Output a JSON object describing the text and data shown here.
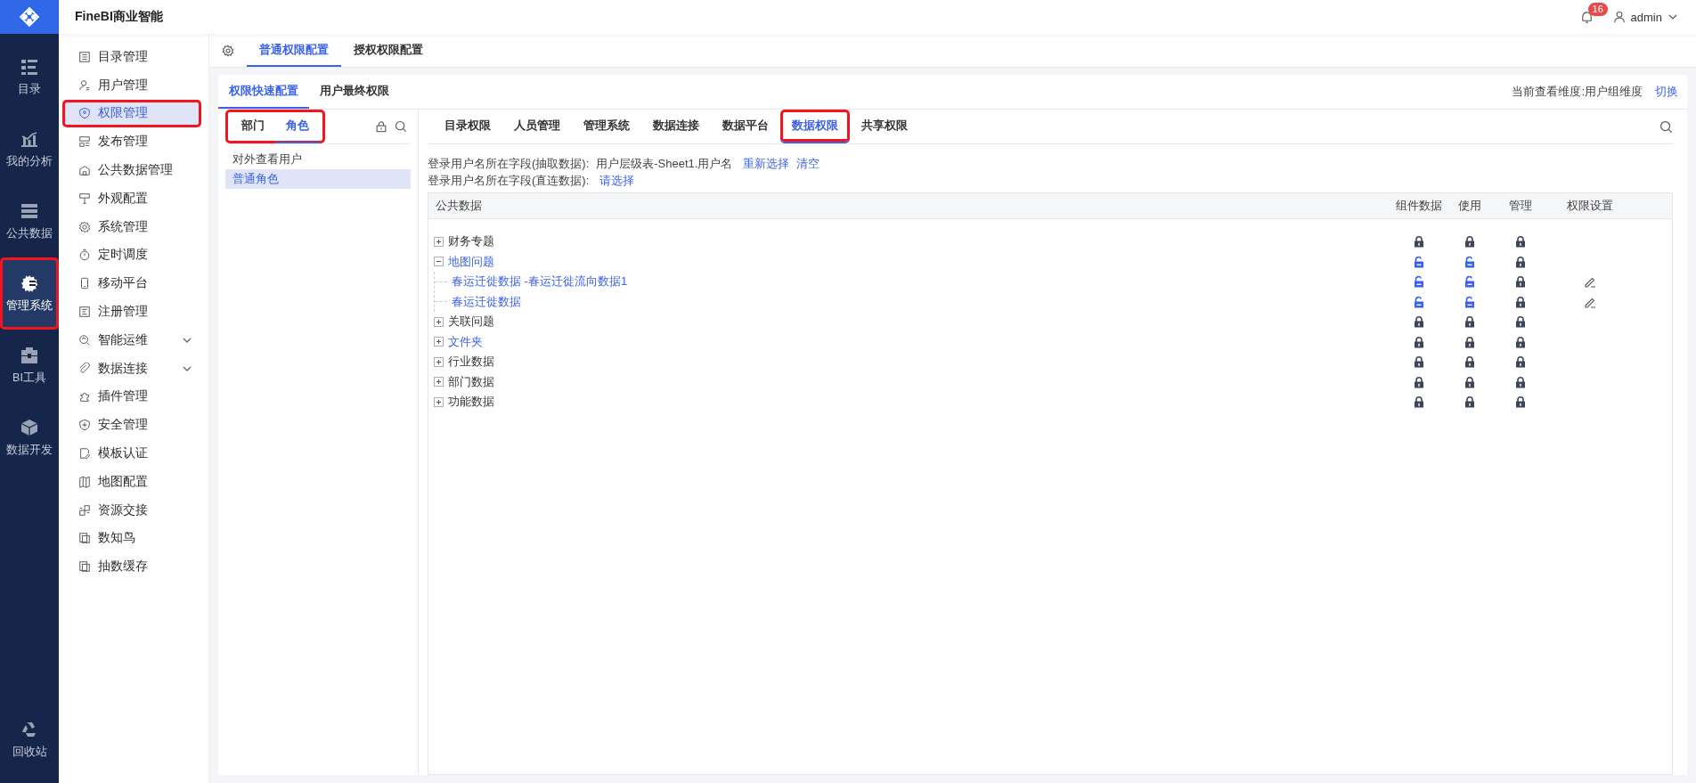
{
  "app": {
    "title": "FineBI商业智能"
  },
  "nav": [
    {
      "label": "目录",
      "selected": false,
      "highlighted": false
    },
    {
      "label": "我的分析",
      "selected": false,
      "highlighted": false
    },
    {
      "label": "公共数据",
      "selected": false,
      "highlighted": false
    },
    {
      "label": "管理系统",
      "selected": true,
      "highlighted": true
    },
    {
      "label": "BI工具",
      "selected": false,
      "highlighted": false
    },
    {
      "label": "数据开发",
      "selected": false,
      "highlighted": false
    }
  ],
  "nav_bottom": {
    "label": "回收站"
  },
  "topbar": {
    "notifications": "16",
    "user": "admin"
  },
  "sidebar": {
    "items": [
      {
        "label": "目录管理",
        "selected": false,
        "highlighted": false,
        "expandable": false
      },
      {
        "label": "用户管理",
        "selected": false,
        "highlighted": false,
        "expandable": false
      },
      {
        "label": "权限管理",
        "selected": true,
        "highlighted": true,
        "expandable": false
      },
      {
        "label": "发布管理",
        "selected": false,
        "highlighted": false,
        "expandable": false
      },
      {
        "label": "公共数据管理",
        "selected": false,
        "highlighted": false,
        "expandable": false
      },
      {
        "label": "外观配置",
        "selected": false,
        "highlighted": false,
        "expandable": false
      },
      {
        "label": "系统管理",
        "selected": false,
        "highlighted": false,
        "expandable": false
      },
      {
        "label": "定时调度",
        "selected": false,
        "highlighted": false,
        "expandable": false
      },
      {
        "label": "移动平台",
        "selected": false,
        "highlighted": false,
        "expandable": false
      },
      {
        "label": "注册管理",
        "selected": false,
        "highlighted": false,
        "expandable": false
      },
      {
        "label": "智能运维",
        "selected": false,
        "highlighted": false,
        "expandable": true
      },
      {
        "label": "数据连接",
        "selected": false,
        "highlighted": false,
        "expandable": true
      },
      {
        "label": "插件管理",
        "selected": false,
        "highlighted": false,
        "expandable": false
      },
      {
        "label": "安全管理",
        "selected": false,
        "highlighted": false,
        "expandable": false
      },
      {
        "label": "模板认证",
        "selected": false,
        "highlighted": false,
        "expandable": false
      },
      {
        "label": "地图配置",
        "selected": false,
        "highlighted": false,
        "expandable": false
      },
      {
        "label": "资源交接",
        "selected": false,
        "highlighted": false,
        "expandable": false
      },
      {
        "label": "数知鸟",
        "selected": false,
        "highlighted": false,
        "expandable": false
      },
      {
        "label": "抽数缓存",
        "selected": false,
        "highlighted": false,
        "expandable": false
      }
    ]
  },
  "main_tabs": [
    {
      "label": "普通权限配置",
      "selected": true
    },
    {
      "label": "授权权限配置",
      "selected": false
    }
  ],
  "card_tabs": [
    {
      "label": "权限快速配置",
      "selected": true
    },
    {
      "label": "用户最终权限",
      "selected": false
    }
  ],
  "dimension": {
    "text": "当前查看维度:用户组维度",
    "action": "切换"
  },
  "group_tabs": {
    "highlighted": true,
    "tabs": [
      {
        "label": "部门",
        "selected": false
      },
      {
        "label": "角色",
        "selected": true
      }
    ]
  },
  "roles": [
    {
      "label": "对外查看用户",
      "selected": false
    },
    {
      "label": "普通角色",
      "selected": true
    }
  ],
  "permission_tabs": [
    {
      "label": "目录权限",
      "selected": false,
      "highlighted": false
    },
    {
      "label": "人员管理",
      "selected": false,
      "highlighted": false
    },
    {
      "label": "管理系统",
      "selected": false,
      "highlighted": false
    },
    {
      "label": "数据连接",
      "selected": false,
      "highlighted": false
    },
    {
      "label": "数据平台",
      "selected": false,
      "highlighted": false
    },
    {
      "label": "数据权限",
      "selected": true,
      "highlighted": true
    },
    {
      "label": "共享权限",
      "selected": false,
      "highlighted": false
    }
  ],
  "field_lines": [
    {
      "label": "登录用户名所在字段(抽取数据):",
      "value": "用户层级表-Sheet1.用户名",
      "actions": [
        "重新选择",
        "清空"
      ]
    },
    {
      "label": "登录用户名所在字段(直连数据):",
      "actions": [
        "请选择"
      ]
    }
  ],
  "table": {
    "columns": [
      "公共数据",
      "组件数据",
      "使用",
      "管理",
      "权限设置"
    ],
    "rows": [
      {
        "label": "财务专题",
        "authorized": false,
        "expanded": false,
        "unlocked": [
          false,
          false,
          false
        ],
        "editable": false
      },
      {
        "label": "地图问题",
        "authorized": true,
        "expanded": true,
        "unlocked": [
          true,
          true,
          false
        ],
        "editable": false,
        "children": [
          {
            "label": "春运迁徙数据 -春运迁徙流向数据1",
            "authorized": true,
            "unlocked": [
              true,
              true,
              false
            ],
            "editable": true
          },
          {
            "label": "春运迁徙数据",
            "authorized": true,
            "unlocked": [
              true,
              true,
              false
            ],
            "editable": true
          }
        ]
      },
      {
        "label": "关联问题",
        "authorized": false,
        "expanded": false,
        "unlocked": [
          false,
          false,
          false
        ],
        "editable": false
      },
      {
        "label": "文件夹",
        "authorized": true,
        "expanded": false,
        "unlocked": [
          false,
          false,
          false
        ],
        "editable": false
      },
      {
        "label": "行业数据",
        "authorized": false,
        "expanded": false,
        "unlocked": [
          false,
          false,
          false
        ],
        "editable": false
      },
      {
        "label": "部门数据",
        "authorized": false,
        "expanded": false,
        "unlocked": [
          false,
          false,
          false
        ],
        "editable": false
      },
      {
        "label": "功能数据",
        "authorized": false,
        "expanded": false,
        "unlocked": [
          false,
          false,
          false
        ],
        "editable": false
      }
    ]
  }
}
